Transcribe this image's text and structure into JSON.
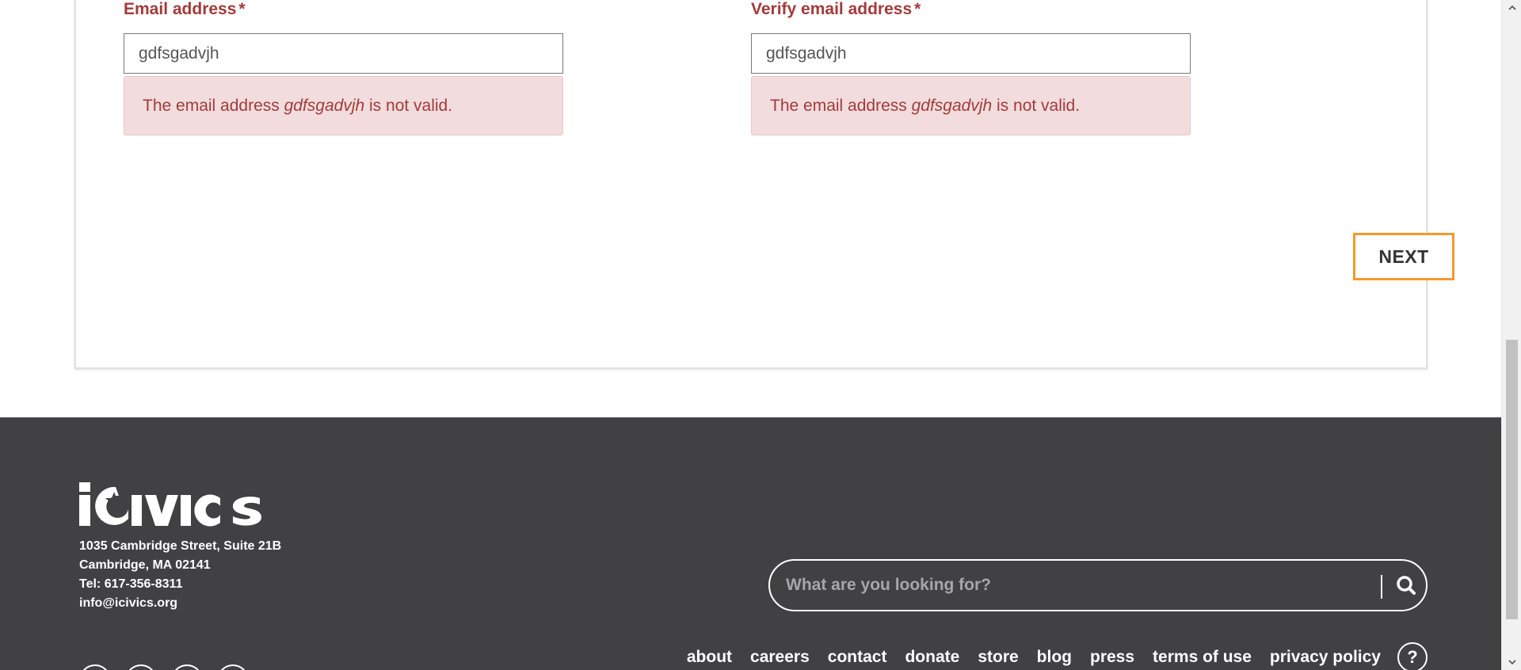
{
  "form": {
    "email": {
      "label": "Email address",
      "required_mark": "*",
      "value": "gdfsgadvjh",
      "error_prefix": "The email address",
      "error_value": "gdfsgadvjh",
      "error_suffix": "is not valid."
    },
    "verify_email": {
      "label": "Verify email address",
      "required_mark": "*",
      "value": "gdfsgadvjh",
      "error_prefix": "The email address",
      "error_value": "gdfsgadvjh",
      "error_suffix": "is not valid."
    },
    "next_label": "NEXT"
  },
  "footer": {
    "logo_text": "iCivics",
    "address": [
      "1035 Cambridge Street, Suite 21B",
      "Cambridge, MA 02141",
      "Tel: 617-356-8311",
      "info@icivics.org"
    ],
    "search": {
      "placeholder": "What are you looking for?"
    },
    "nav": {
      "about": "about",
      "careers": "careers",
      "contact": "contact",
      "donate": "donate",
      "store": "store",
      "blog": "blog",
      "press": "press",
      "terms": "terms of use",
      "privacy": "privacy policy",
      "help": "?"
    }
  },
  "colors": {
    "error_text": "#a23b3b",
    "error_bg": "#f2dcdd",
    "next_border": "#f29a2e",
    "footer_bg": "#414042"
  }
}
